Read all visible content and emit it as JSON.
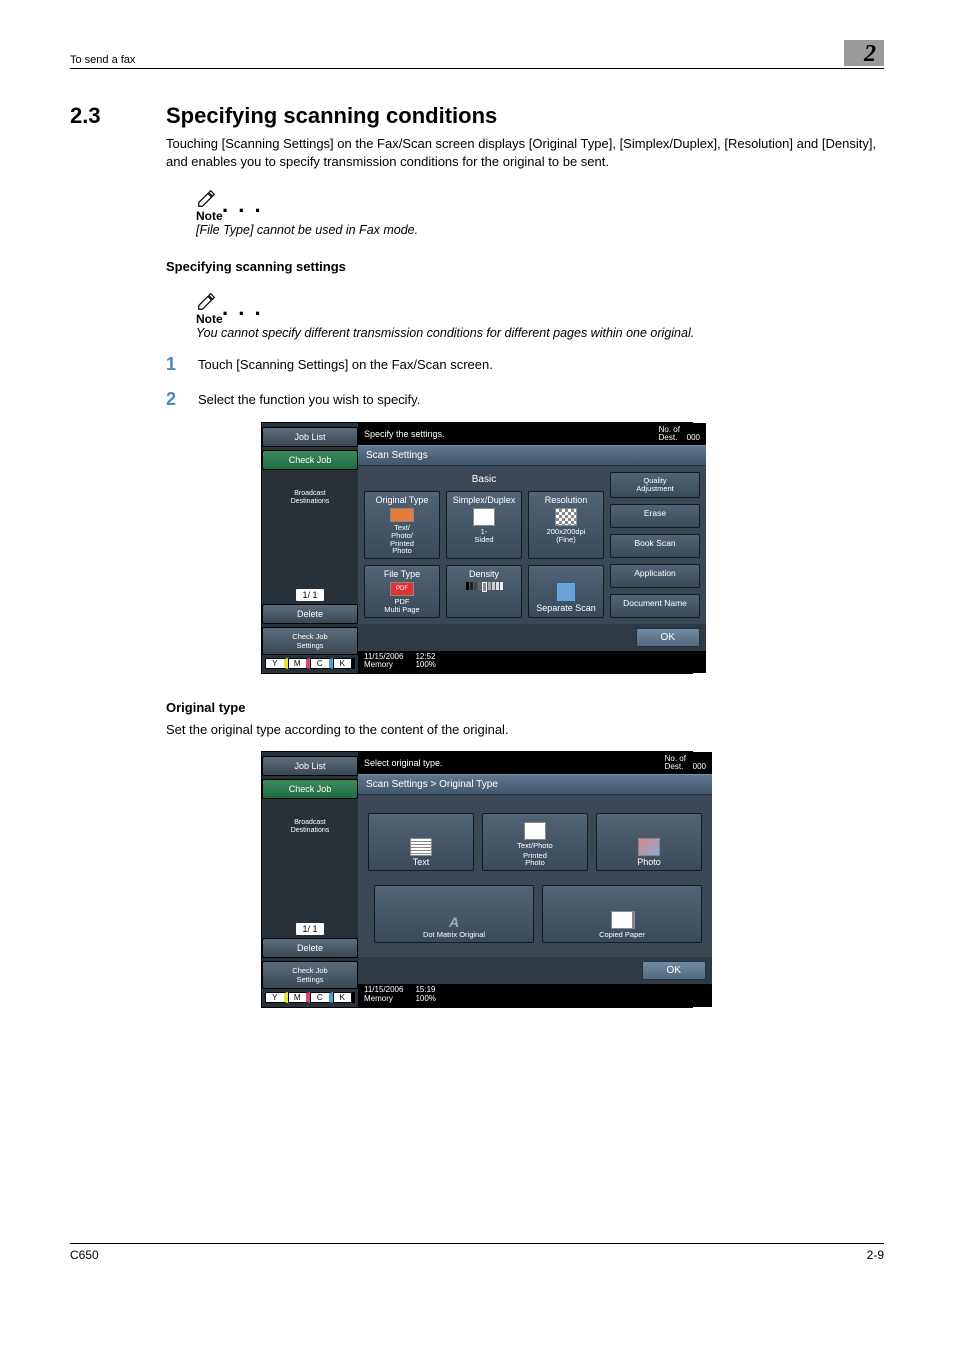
{
  "header": {
    "left": "To send a fax",
    "chapter": "2"
  },
  "section": {
    "number": "2.3",
    "title": "Specifying scanning conditions",
    "intro": "Touching [Scanning Settings] on the Fax/Scan screen displays [Original Type], [Simplex/Duplex], [Resolution] and [Density], and enables you to specify transmission conditions for the original to be sent."
  },
  "note1": {
    "head": "Note",
    "body": "[File Type] cannot be used in Fax mode."
  },
  "subhead1": "Specifying scanning settings",
  "note2": {
    "head": "Note",
    "body": "You cannot specify different transmission conditions for different pages within one original."
  },
  "steps": [
    {
      "n": "1",
      "t": "Touch [Scanning Settings] on the Fax/Scan screen."
    },
    {
      "n": "2",
      "t": "Select the function you wish to specify."
    }
  ],
  "origHead": "Original type",
  "origBody": "Set the original type according to the content of the original.",
  "footer": {
    "left": "C650",
    "right": "2-9"
  },
  "scr_common": {
    "job_list": "Job List",
    "check_job": "Check Job",
    "broadcast": "Broadcast\nDestinations",
    "pager": "1/   1",
    "delete": "Delete",
    "check_job_settings": "Check Job\nSettings",
    "y": "Y",
    "m": "M",
    "c": "C",
    "k": "K",
    "dest_label": "No. of\nDest.",
    "dest_count": "000",
    "ok": "OK",
    "memory": "Memory",
    "mem_pct": "100%"
  },
  "scr1": {
    "prompt": "Specify the settings.",
    "band": "Scan Settings",
    "basic": "Basic",
    "original_type": "Original Type",
    "simplex": "Simplex/Duplex",
    "resolution": "Resolution",
    "ot_sub": "Text/\nPhoto/\nPrinted\nPhoto",
    "sd_sub": "1-\nSided",
    "res_sub": "200x200dpi\n(Fine)",
    "file_type": "File Type",
    "density": "Density",
    "ft_sub": "PDF\nMulti Page",
    "pdf_badge": "PDF",
    "sep_scan": "Separate Scan",
    "quality": "Quality\nAdjustment",
    "erase": "Erase",
    "book": "Book Scan",
    "application": "Application",
    "doc_name": "Document Name",
    "date": "11/15/2006",
    "time": "12:52"
  },
  "scr2": {
    "prompt": "Select original type.",
    "band": "Scan Settings > Original Type",
    "text": "Text",
    "textphoto1": "Text/Photo",
    "textphoto2": "Printed\nPhoto",
    "photo": "Photo",
    "dotmatrix": "Dot Matrix Original",
    "copied": "Copied Paper",
    "date": "11/15/2006",
    "time": "15:19"
  }
}
